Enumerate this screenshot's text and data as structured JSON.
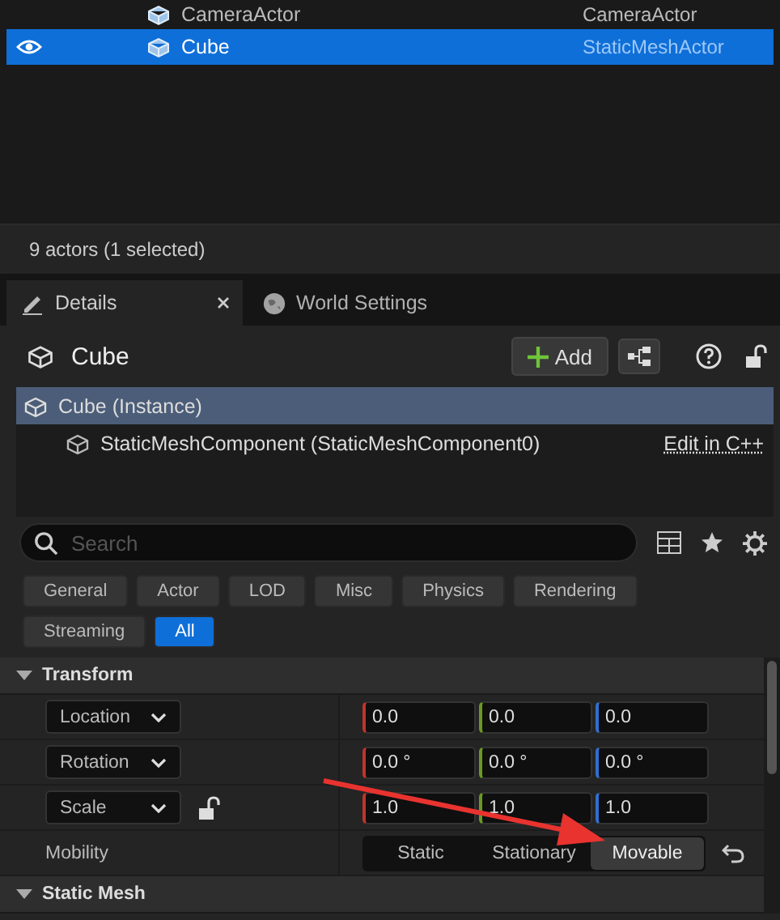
{
  "outliner": {
    "rows": [
      {
        "label": "CameraActor",
        "type": "CameraActor",
        "visible": false,
        "selected": false
      },
      {
        "label": "Cube",
        "type": "StaticMeshActor",
        "visible": true,
        "selected": true
      }
    ],
    "status": "9 actors (1 selected)"
  },
  "tabs": [
    {
      "label": "Details",
      "selected": true
    },
    {
      "label": "World Settings",
      "selected": false
    }
  ],
  "details": {
    "title": "Cube",
    "add_button": "Add",
    "components": [
      {
        "label": "Cube (Instance)",
        "selected": true,
        "children": [
          {
            "label": "StaticMeshComponent (StaticMeshComponent0)",
            "selected": false,
            "link": "Edit in C++"
          }
        ]
      }
    ],
    "search": {
      "placeholder": "Search"
    },
    "filters": [
      {
        "label": "General",
        "selected": false
      },
      {
        "label": "Actor",
        "selected": false
      },
      {
        "label": "LOD",
        "selected": false
      },
      {
        "label": "Misc",
        "selected": false
      },
      {
        "label": "Physics",
        "selected": false
      },
      {
        "label": "Rendering",
        "selected": false
      },
      {
        "label": "Streaming",
        "selected": false
      },
      {
        "label": "All",
        "selected": true
      }
    ],
    "sections": [
      {
        "title": "Transform",
        "expanded": true,
        "rows": [
          {
            "kind": "vector",
            "label": "Location",
            "has_lock": false,
            "values": [
              "0.0",
              "0.0",
              "0.0"
            ]
          },
          {
            "kind": "vector",
            "label": "Rotation",
            "has_lock": false,
            "values": [
              "0.0 °",
              "0.0 °",
              "0.0 °"
            ]
          },
          {
            "kind": "vector",
            "label": "Scale",
            "has_lock": true,
            "values": [
              "1.0",
              "1.0",
              "1.0"
            ]
          },
          {
            "kind": "choice",
            "label": "Mobility",
            "options": [
              {
                "label": "Static",
                "selected": false
              },
              {
                "label": "Stationary",
                "selected": false
              },
              {
                "label": "Movable",
                "selected": true
              }
            ]
          }
        ]
      },
      {
        "title": "Static Mesh",
        "expanded": true
      }
    ]
  }
}
